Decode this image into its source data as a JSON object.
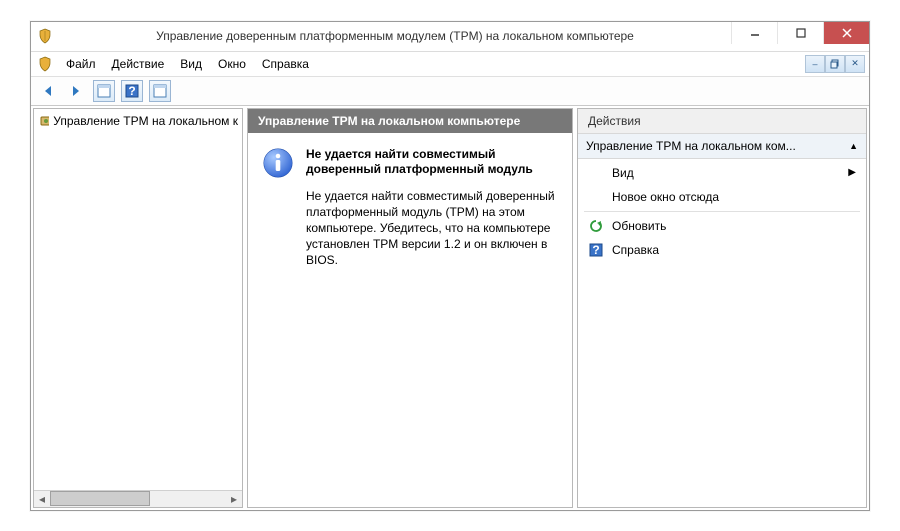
{
  "window": {
    "title": "Управление доверенным платформенным модулем (TPM) на локальном компьютере"
  },
  "menu": {
    "file": "Файл",
    "action": "Действие",
    "view": "Вид",
    "window": "Окно",
    "help": "Справка"
  },
  "tree": {
    "item": "Управление TPM на локальном к"
  },
  "middle": {
    "header": "Управление TPM на локальном компьютере",
    "heading": "Не удается найти совместимый доверенный платформенный модуль",
    "body": "Не удается найти совместимый доверенный платформенный модуль (TPM) на этом компьютере. Убедитесь, что на компьютере установлен TPM версии 1.2 и он включен в BIOS."
  },
  "actions": {
    "header": "Действия",
    "section": "Управление TPM на локальном ком...",
    "items": {
      "view": "Вид",
      "newwin": "Новое окно отсюда",
      "refresh": "Обновить",
      "help": "Справка"
    }
  }
}
